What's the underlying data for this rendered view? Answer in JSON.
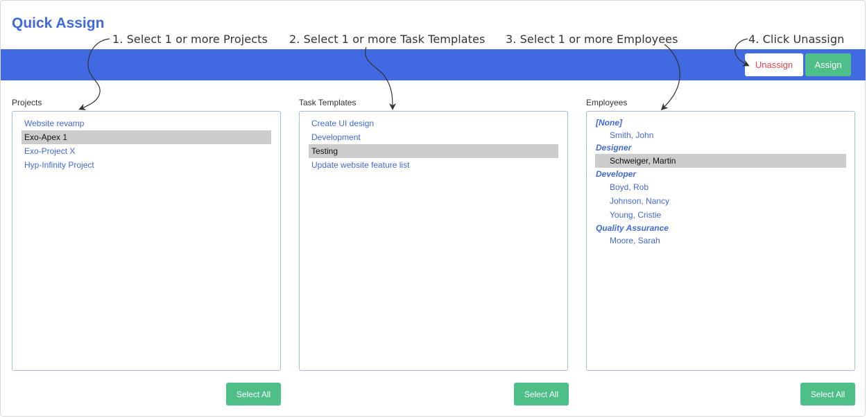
{
  "title": "Quick Assign",
  "annotations": [
    "1. Select 1 or more Projects",
    "2. Select 1 or more Task Templates",
    "3. Select 1 or more Employees",
    "4. Click Unassign"
  ],
  "toolbar": {
    "unassign_label": "Unassign",
    "assign_label": "Assign"
  },
  "projects": {
    "label": "Projects",
    "items": [
      {
        "name": "Website revamp",
        "selected": false
      },
      {
        "name": "Exo-Apex 1",
        "selected": true
      },
      {
        "name": "Exo-Project X",
        "selected": false
      },
      {
        "name": "Hyp-Infinity Project",
        "selected": false
      }
    ],
    "select_all_label": "Select All"
  },
  "task_templates": {
    "label": "Task Templates",
    "items": [
      {
        "name": "Create UI design",
        "selected": false
      },
      {
        "name": "Development",
        "selected": false
      },
      {
        "name": "Testing",
        "selected": true
      },
      {
        "name": "Update website feature list",
        "selected": false
      }
    ],
    "select_all_label": "Select All"
  },
  "employees": {
    "label": "Employees",
    "groups": [
      {
        "group": "[None]",
        "members": [
          {
            "name": "Smith, John",
            "selected": false
          }
        ]
      },
      {
        "group": "Designer",
        "members": [
          {
            "name": "Schweiger, Martin",
            "selected": true
          }
        ]
      },
      {
        "group": "Developer",
        "members": [
          {
            "name": "Boyd, Rob",
            "selected": false
          },
          {
            "name": "Johnson, Nancy",
            "selected": false
          },
          {
            "name": "Young, Cristie",
            "selected": false
          }
        ]
      },
      {
        "group": "Quality Assurance",
        "members": [
          {
            "name": "Moore, Sarah",
            "selected": false
          }
        ]
      }
    ],
    "select_all_label": "Select All"
  },
  "colors": {
    "accent": "#4169e1",
    "success": "#4fbf8a",
    "danger": "#e8454f",
    "selection": "#cccccc"
  }
}
